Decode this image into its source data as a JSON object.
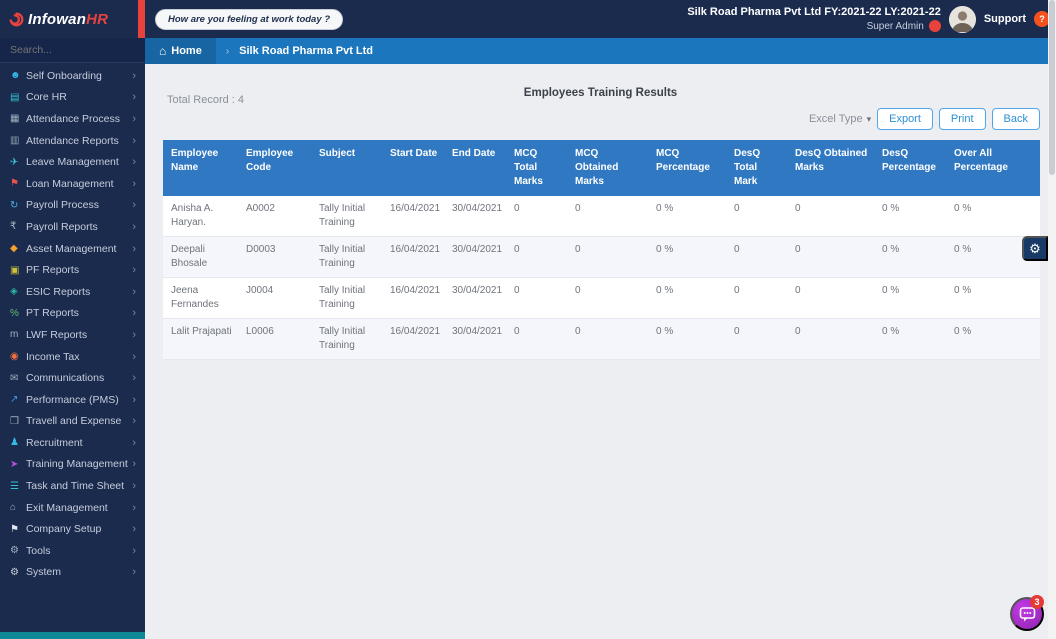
{
  "app": {
    "logo_prefix": "Infowan",
    "logo_suffix": "HR"
  },
  "topbar": {
    "mood_question": "How are you feeling at work today ?",
    "company_line": "Silk Road Pharma Pvt Ltd FY:2021-22 LY:2021-22",
    "user_role": "Super Admin",
    "support_label": "Support",
    "support_icon_glyph": "?"
  },
  "sidebar": {
    "search_placeholder": "Search...",
    "chevron_glyph": "›",
    "items": [
      {
        "label": "Self Onboarding",
        "icon": "person-icon",
        "glyph": "☻",
        "color": "#35b9e6"
      },
      {
        "label": "Core HR",
        "icon": "layers-icon",
        "glyph": "▤",
        "color": "#2fc4cf"
      },
      {
        "label": "Attendance Process",
        "icon": "checklist-icon",
        "glyph": "▦",
        "color": "#9fb0bf"
      },
      {
        "label": "Attendance Reports",
        "icon": "calendar-icon",
        "glyph": "▥",
        "color": "#8fa3b0"
      },
      {
        "label": "Leave Management",
        "icon": "paper-plane-icon",
        "glyph": "✈",
        "color": "#3ec6d8"
      },
      {
        "label": "Loan Management",
        "icon": "flag-icon",
        "glyph": "⚑",
        "color": "#e8534d"
      },
      {
        "label": "Payroll Process",
        "icon": "sync-icon",
        "glyph": "↻",
        "color": "#49b6f0"
      },
      {
        "label": "Payroll Reports",
        "icon": "rupee-icon",
        "glyph": "₹",
        "color": "#aab8c6"
      },
      {
        "label": "Asset Management",
        "icon": "gem-icon",
        "glyph": "◆",
        "color": "#f5a12b"
      },
      {
        "label": "PF Reports",
        "icon": "briefcase-icon",
        "glyph": "▣",
        "color": "#c9c23a"
      },
      {
        "label": "ESIC Reports",
        "icon": "diamond-icon",
        "glyph": "◈",
        "color": "#2fb5a0"
      },
      {
        "label": "PT Reports",
        "icon": "percent-icon",
        "glyph": "%",
        "color": "#5fc06a"
      },
      {
        "label": "LWF Reports",
        "icon": "lwf-icon",
        "glyph": "m",
        "color": "#9fb0bf"
      },
      {
        "label": "Income Tax",
        "icon": "ink-icon",
        "glyph": "◉",
        "color": "#f2703f"
      },
      {
        "label": "Communications",
        "icon": "chat-icon",
        "glyph": "✉",
        "color": "#9fb0bf"
      },
      {
        "label": "Performance (PMS)",
        "icon": "chart-icon",
        "glyph": "↗",
        "color": "#3f9ae8"
      },
      {
        "label": "Travell and Expense",
        "icon": "map-icon",
        "glyph": "❒",
        "color": "#9fb0bf"
      },
      {
        "label": "Recruitment",
        "icon": "person-add-icon",
        "glyph": "♟",
        "color": "#35b9e6"
      },
      {
        "label": "Training Management",
        "icon": "send-icon",
        "glyph": "➤",
        "color": "#b04fd8"
      },
      {
        "label": "Task and Time Sheet",
        "icon": "list-icon",
        "glyph": "☰",
        "color": "#2fc4cf"
      },
      {
        "label": "Exit Management",
        "icon": "home-icon",
        "glyph": "⌂",
        "color": "#9fb0bf"
      },
      {
        "label": "Company Setup",
        "icon": "flag-icon",
        "glyph": "⚑",
        "color": "#dfe6ee"
      },
      {
        "label": "Tools",
        "icon": "gear-icon",
        "glyph": "⚙",
        "color": "#9fb0bf"
      },
      {
        "label": "System",
        "icon": "gear-icon",
        "glyph": "⚙",
        "color": "#c6d0da"
      }
    ]
  },
  "breadcrumb": {
    "home_icon_glyph": "⌂",
    "home_label": "Home",
    "separator": "›",
    "page_label": "Silk Road Pharma Pvt Ltd"
  },
  "main": {
    "total_record_label": "Total Record : 4",
    "title": "Employees Training Results",
    "excel_type_label": "Excel Type",
    "excel_type_chevron": "▾",
    "export_label": "Export",
    "print_label": "Print",
    "back_label": "Back"
  },
  "table": {
    "columns": [
      "Employee Name",
      "Employee Code",
      "Subject",
      "Start Date",
      "End Date",
      "MCQ Total Marks",
      "MCQ Obtained Marks",
      "MCQ Percentage",
      "DesQ Total Mark",
      "DesQ Obtained Marks",
      "DesQ Percentage",
      "Over All Percentage"
    ],
    "rows": [
      [
        "Anisha A. Haryan.",
        "A0002",
        "Tally Initial Training",
        "16/04/2021",
        "30/04/2021",
        "0",
        "0",
        "0 %",
        "0",
        "0",
        "0 %",
        "0 %"
      ],
      [
        "Deepali Bhosale",
        "D0003",
        "Tally Initial Training",
        "16/04/2021",
        "30/04/2021",
        "0",
        "0",
        "0 %",
        "0",
        "0",
        "0 %",
        "0 %"
      ],
      [
        "Jeena Fernandes",
        "J0004",
        "Tally Initial Training",
        "16/04/2021",
        "30/04/2021",
        "0",
        "0",
        "0 %",
        "0",
        "0",
        "0 %",
        "0 %"
      ],
      [
        "Lalit Prajapati",
        "L0006",
        "Tally Initial Training",
        "16/04/2021",
        "30/04/2021",
        "0",
        "0",
        "0 %",
        "0",
        "0",
        "0 %",
        "0 %"
      ]
    ]
  },
  "fab": {
    "gear_glyph": "⚙",
    "chat_badge": "3"
  },
  "colors": {
    "navy": "#1b2b4e",
    "breadcrumb_blue": "#1b76be",
    "table_header_blue": "#3078c1",
    "accent_red": "#e8423d",
    "button_blue": "#2a8fd8",
    "chat_purple": "#9c27b0"
  }
}
